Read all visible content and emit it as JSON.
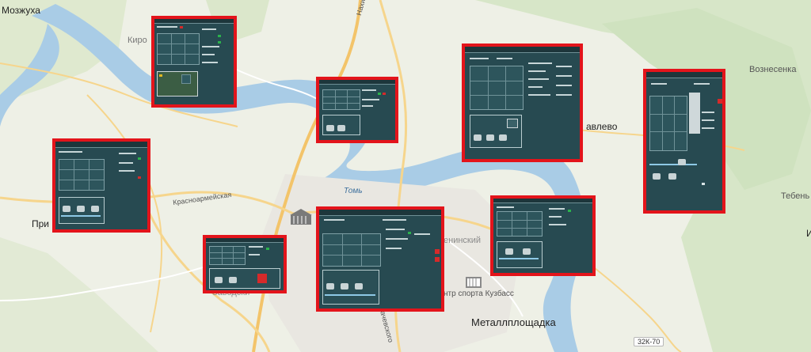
{
  "map": {
    "labels": {
      "mozhukha": "Мозжуха",
      "kiro": "Киро",
      "nakhimova": "Нахимова",
      "voznesenka": "Вознесенка",
      "avlevo": "авлево",
      "tebenkaya": "Тебень",
      "pri": "При",
      "krasnoarmeyskaya": "Красноармейская",
      "tom": "Томь",
      "leninsky": "енинский",
      "sport": "нтр спорта Кузбасс",
      "zavodsky": "Заводски",
      "metallploshchadka": "Металлплощадка",
      "road_badge": "32К-70",
      "yaskogo": "ачевского",
      "i": "И"
    }
  },
  "panels": [
    {
      "id": "p1"
    },
    {
      "id": "p2"
    },
    {
      "id": "p3"
    },
    {
      "id": "p4"
    },
    {
      "id": "p5"
    },
    {
      "id": "p6"
    },
    {
      "id": "p7"
    },
    {
      "id": "p8"
    }
  ]
}
